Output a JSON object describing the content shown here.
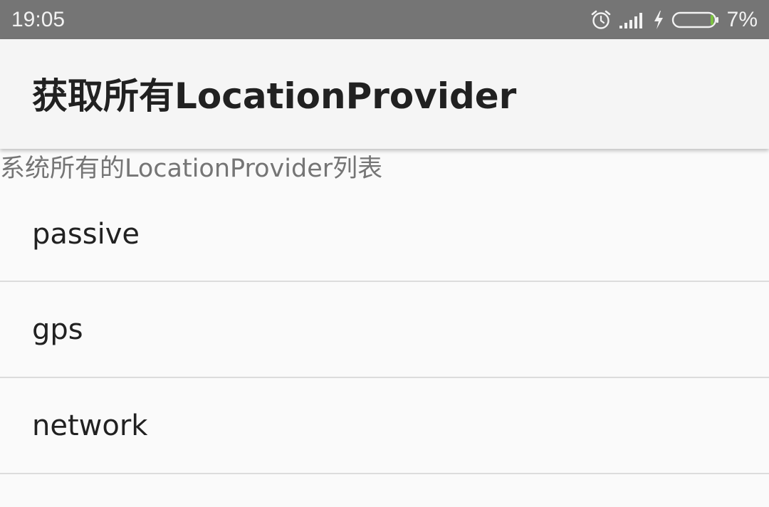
{
  "status_bar": {
    "time": "19:05",
    "battery_percent": "7%",
    "battery_level": 0.07,
    "icons": [
      "alarm-icon",
      "signal-icon",
      "charging-icon",
      "battery-icon"
    ],
    "background": "#757575",
    "battery_fill_color": "#7cc241"
  },
  "app_bar": {
    "title": "获取所有LocationProvider",
    "background": "#f5f5f5"
  },
  "list": {
    "header": "系统所有的LocationProvider列表",
    "items": [
      {
        "label": "passive"
      },
      {
        "label": "gps"
      },
      {
        "label": "network"
      }
    ]
  }
}
